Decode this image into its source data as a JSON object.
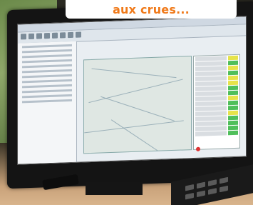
{
  "caption": {
    "text": "aux crues..."
  },
  "colors": {
    "caption_text": "#f07a1a",
    "caption_bg": "#ffffff",
    "table_yellow": "#e6e34a",
    "table_green": "#4fbf5a"
  }
}
